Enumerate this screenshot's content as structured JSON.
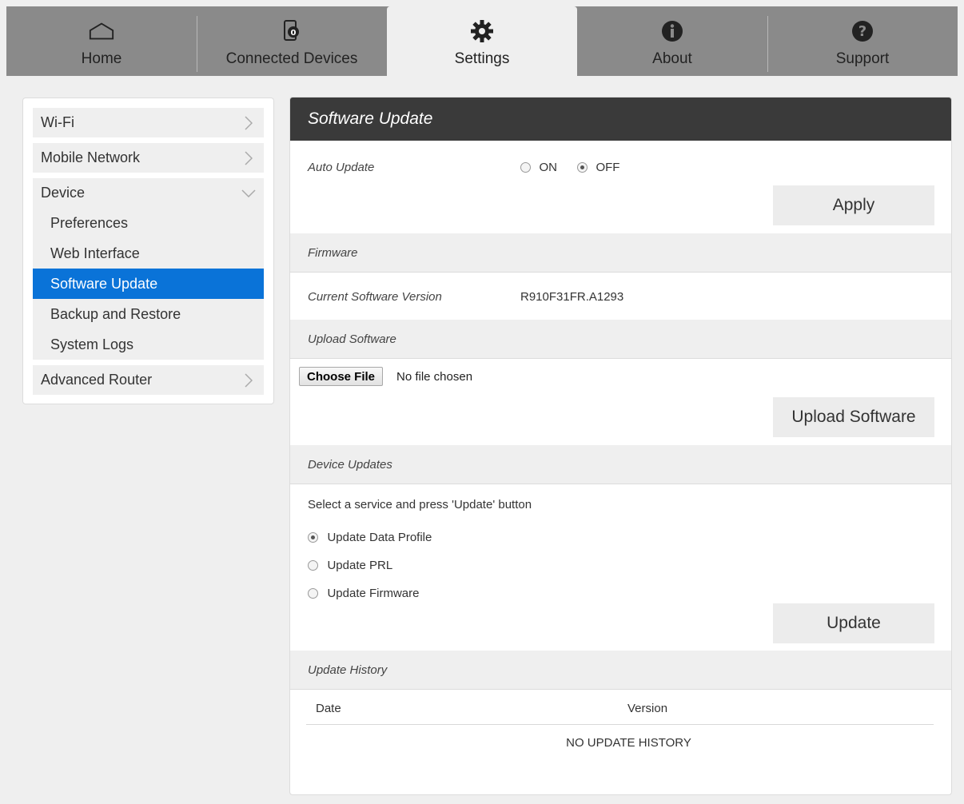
{
  "nav": {
    "tabs": [
      {
        "label": "Home",
        "icon": "home-icon"
      },
      {
        "label": "Connected Devices",
        "icon": "connected-devices-icon"
      },
      {
        "label": "Settings",
        "icon": "gear-icon"
      },
      {
        "label": "About",
        "icon": "info-icon"
      },
      {
        "label": "Support",
        "icon": "question-icon"
      }
    ],
    "active": "Settings"
  },
  "sidebar": {
    "wifi": "Wi-Fi",
    "mobile_network": "Mobile Network",
    "device": "Device",
    "device_items": [
      "Preferences",
      "Web Interface",
      "Software Update",
      "Backup and Restore",
      "System Logs"
    ],
    "active_item": "Software Update",
    "advanced_router": "Advanced Router"
  },
  "main": {
    "title": "Software Update",
    "auto_update": {
      "label": "Auto Update",
      "on": "ON",
      "off": "OFF",
      "selected": "OFF"
    },
    "apply_label": "Apply",
    "firmware": {
      "section": "Firmware",
      "version_label": "Current Software Version",
      "version_value": "R910F31FR.A1293"
    },
    "upload": {
      "section": "Upload Software",
      "choose_file": "Choose File",
      "no_file": "No file chosen",
      "button": "Upload Software"
    },
    "device_updates": {
      "section": "Device Updates",
      "instruction": "Select a service and press 'Update' button",
      "options": [
        "Update Data Profile",
        "Update PRL",
        "Update Firmware"
      ],
      "selected": "Update Data Profile",
      "button": "Update"
    },
    "history": {
      "section": "Update History",
      "col_date": "Date",
      "col_version": "Version",
      "empty": "NO UPDATE HISTORY"
    }
  },
  "colors": {
    "accent": "#0a73d8",
    "nav_bg": "#8a8a8a",
    "header_bg": "#3a3a3a"
  }
}
